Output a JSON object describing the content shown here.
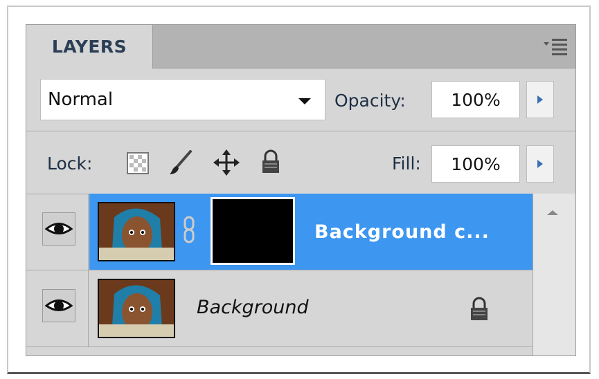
{
  "panel": {
    "tab_label": "LAYERS",
    "menu_icon": "panel-menu-icon"
  },
  "blending": {
    "mode": "Normal",
    "opacity_label": "Opacity:",
    "opacity_value": "100%"
  },
  "lock": {
    "label": "Lock:",
    "icons": [
      "lock-transparent-pixels-icon",
      "lock-image-pixels-icon",
      "lock-position-icon",
      "lock-all-icon"
    ],
    "fill_label": "Fill:",
    "fill_value": "100%"
  },
  "layers": [
    {
      "name": "Background c...",
      "selected": true,
      "has_mask": true,
      "visible": true
    },
    {
      "name": "Background",
      "selected": false,
      "locked": true,
      "visible": true
    }
  ],
  "colors": {
    "selection": "#3d96f0",
    "panel_bg": "#d6d6d6",
    "label_text": "#1e2f44"
  }
}
